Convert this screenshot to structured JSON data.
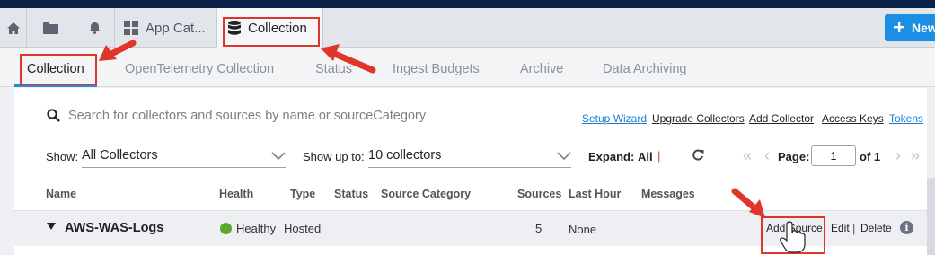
{
  "tabs": [
    {
      "icon": "home-icon"
    },
    {
      "icon": "folder-icon"
    },
    {
      "icon": "bell-icon"
    },
    {
      "icon": "grid-icon",
      "label": "App Cat..."
    },
    {
      "icon": "database-icon",
      "label": "Collection"
    }
  ],
  "new_button": {
    "label": "New"
  },
  "subnav": [
    "Collection",
    "OpenTelemetry Collection",
    "Status",
    "Ingest Budgets",
    "Archive",
    "Data Archiving"
  ],
  "search": {
    "placeholder": "Search for collectors and sources by name or sourceCategory"
  },
  "links": [
    "Setup Wizard",
    "Upgrade Collectors",
    "Add Collector",
    "Access Keys",
    "Tokens"
  ],
  "filters": {
    "show_label": "Show:",
    "show_value": "All Collectors",
    "showupto_label": "Show up to:",
    "showupto_value": "10 collectors",
    "expand_label": "Expand:",
    "expand_value": "All",
    "page_label": "Page:",
    "page_value": "1",
    "page_total": "of 1"
  },
  "table": {
    "headers": [
      "Name",
      "Health",
      "Type",
      "Status",
      "Source Category",
      "Sources",
      "Last Hour",
      "Messages"
    ],
    "rows": [
      {
        "name": "AWS-WAS-Logs",
        "health": "Healthy",
        "type": "Hosted",
        "status": "",
        "source_category": "",
        "sources": "5",
        "last_hour": "None",
        "messages": "",
        "actions": [
          "Add Source",
          "Edit",
          "Delete"
        ]
      }
    ]
  },
  "colors": {
    "accent": "#1a8fe3",
    "annotation": "#e0352b",
    "healthy": "#5da82f",
    "header_bar": "#0b2248"
  }
}
